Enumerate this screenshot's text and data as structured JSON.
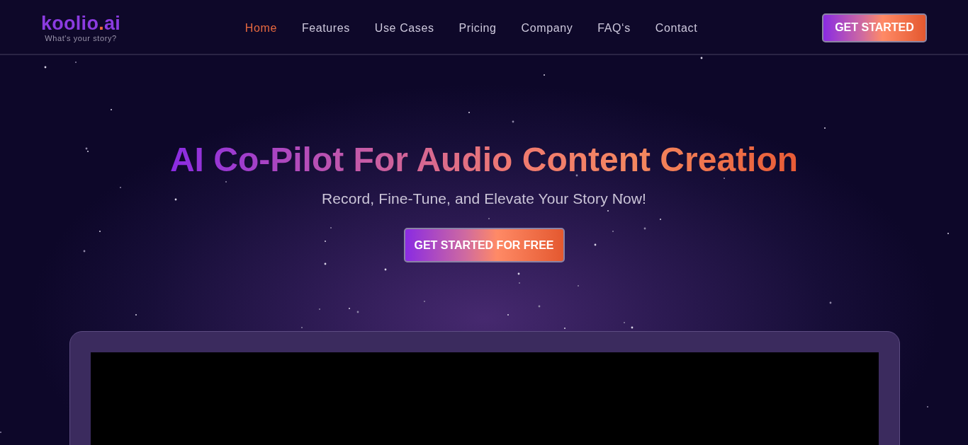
{
  "header": {
    "logo": {
      "name": "koolio",
      "dot": ".",
      "suffix": "ai"
    },
    "tagline": "What's your story?",
    "nav": [
      {
        "label": "Home",
        "selected": true
      },
      {
        "label": "Features",
        "selected": false
      },
      {
        "label": "Use Cases",
        "selected": false
      },
      {
        "label": "Pricing",
        "selected": false
      },
      {
        "label": "Company",
        "selected": false
      },
      {
        "label": "FAQ‘s",
        "selected": false
      },
      {
        "label": "Contact",
        "selected": false
      }
    ],
    "cta": "GET STARTED"
  },
  "hero": {
    "title": "AI Co-Pilot For Audio Content Creation",
    "subtitle": "Record, Fine-Tune, and Elevate Your Story Now!",
    "cta": "GET STARTED FOR FREE"
  }
}
